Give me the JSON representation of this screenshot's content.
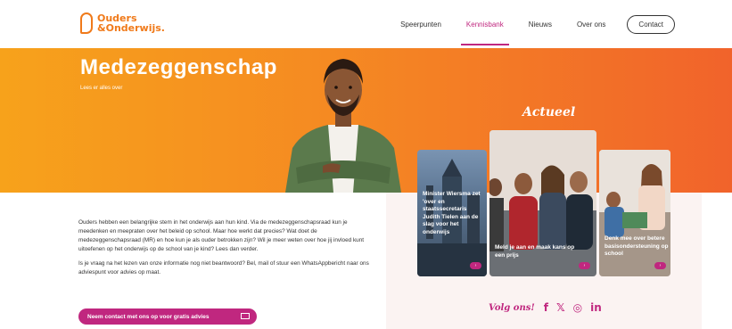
{
  "header": {
    "logo_line1": "Ouders",
    "logo_line2": "&Onderwijs.",
    "nav": [
      {
        "label": "Speerpunten",
        "active": false
      },
      {
        "label": "Kennisbank",
        "active": true
      },
      {
        "label": "Nieuws",
        "active": false
      },
      {
        "label": "Over ons",
        "active": false
      }
    ],
    "contact_label": "Contact"
  },
  "hero": {
    "title": "Medezeggenschap",
    "subtitle": "Lees er alles over"
  },
  "actueel": {
    "title": "Actueel",
    "cards": [
      {
        "text": "Minister Wiersma zet 'over en staatssecretaris Judith Tielen aan de slag voor het onderwijs"
      },
      {
        "text": "Meld je aan en maak kans op een prijs"
      },
      {
        "text": "Denk mee over betere basisondersteuning op school"
      }
    ]
  },
  "intro": {
    "p1": "Ouders hebben een belangrijke stem in het onderwijs aan hun kind. Via de medezeggenschapsraad kun je meedenken en meepraten over het beleid op school. Maar hoe werkt dat precies? Wat doet de medezeggenschapsraad (MR) en hoe kun je als ouder betrokken zijn? Wil je meer weten over hoe jij invloed kunt uitoefenen op het onderwijs op de school van je kind? Lees dan verder.",
    "p2": "Is je vraag na het lezen van onze informatie nog niet beantwoord? Bel, mail of stuur een WhatsAppbericht naar ons adviespunt voor advies op maat."
  },
  "cta_label": "Neem contact met ons op voor gratis advies",
  "social": {
    "follow_label": "Volg ons!",
    "facebook": "f",
    "x": "𝕏",
    "instagram": "◎",
    "linkedin": "in"
  },
  "colors": {
    "brand_orange": "#f07a1a",
    "accent_magenta": "#c0277f"
  }
}
